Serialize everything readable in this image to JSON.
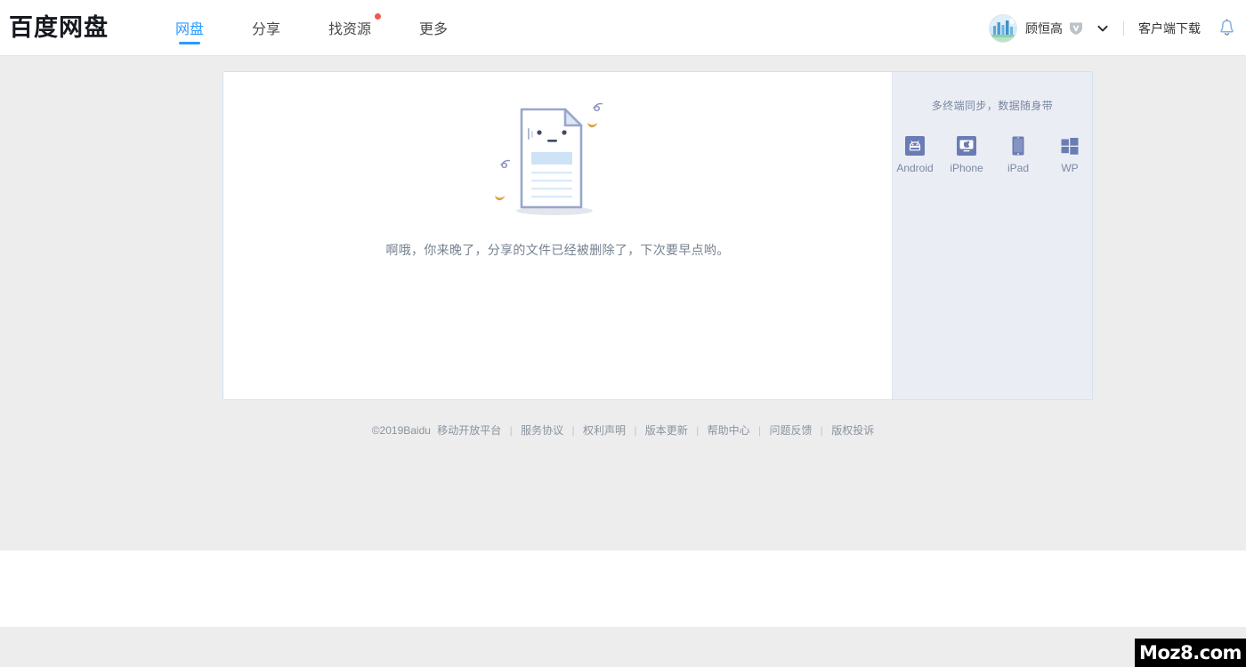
{
  "header": {
    "brand": "百度网盘",
    "nav": [
      {
        "label": "网盘",
        "active": true,
        "dot": false
      },
      {
        "label": "分享",
        "active": false,
        "dot": false
      },
      {
        "label": "找资源",
        "active": false,
        "dot": true
      },
      {
        "label": "更多",
        "active": false,
        "dot": false
      }
    ],
    "user": {
      "name": "顾恒高",
      "vip_badge": "vip-diamond-icon",
      "caret": "chevron-down-icon",
      "avatar": "user-avatar"
    },
    "client_download": "客户端下载",
    "notification": "bell-icon",
    "accent_color": "#2b99ff",
    "dot_color": "#f4564f"
  },
  "main": {
    "message": "啊哦，你来晚了，分享的文件已经被删除了，下次要早点哟。",
    "illustration": "deleted-file-document-illustration"
  },
  "sidebar": {
    "title": "多终端同步，数据随身带",
    "apps": [
      {
        "label": "Android",
        "icon": "android-icon"
      },
      {
        "label": "iPhone",
        "icon": "iphone-icon"
      },
      {
        "label": "iPad",
        "icon": "ipad-icon"
      },
      {
        "label": "WP",
        "icon": "windows-phone-icon"
      }
    ]
  },
  "footer": {
    "copyright": "©2019Baidu",
    "links": [
      "移动开放平台",
      "服务协议",
      "权利声明",
      "版本更新",
      "帮助中心",
      "问题反馈",
      "版权投诉"
    ],
    "separator": "|"
  },
  "watermark": {
    "text": "Moz8.com"
  }
}
